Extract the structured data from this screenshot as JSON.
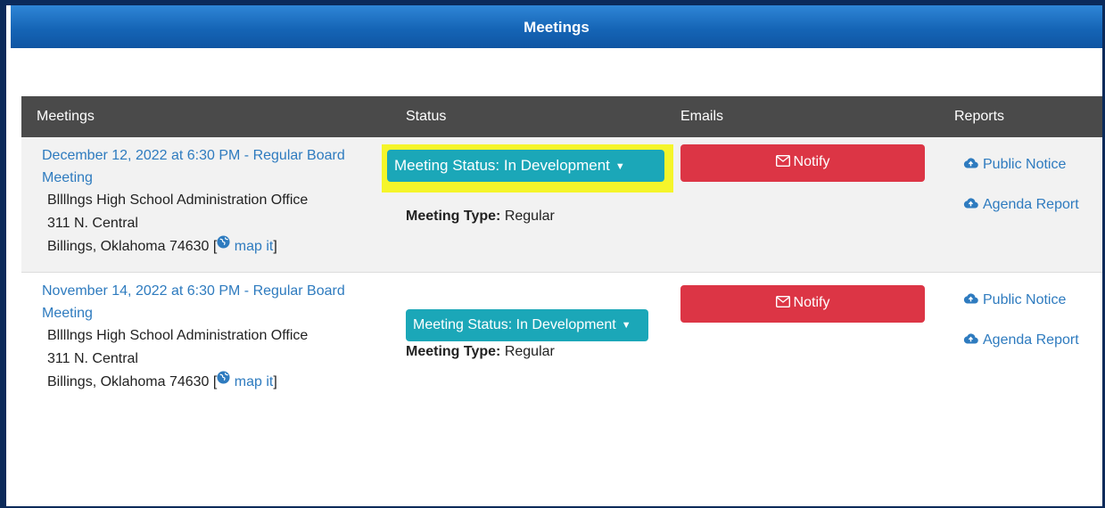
{
  "header": {
    "title": "Meetings"
  },
  "table": {
    "columns": [
      "Meetings",
      "Status",
      "Emails",
      "Reports"
    ],
    "rows": [
      {
        "meeting_title": "December 12, 2022 at 6:30 PM - Regular Board Meeting",
        "address": {
          "line1": "Bllllngs High School Administration Office",
          "line2": "311 N. Central",
          "line3": "Billings, Oklahoma 74630 [",
          "map_link": "map it",
          "line3_end": "]"
        },
        "status_button": "Meeting Status: In Development",
        "meeting_type_label": "Meeting Type:",
        "meeting_type_value": "Regular",
        "notify_label": "Notify",
        "reports": {
          "public_notice": "Public Notice",
          "agenda_report": "Agenda Report"
        },
        "highlighted": true
      },
      {
        "meeting_title": "November 14, 2022 at 6:30 PM - Regular Board Meeting",
        "address": {
          "line1": "Bllllngs High School Administration Office",
          "line2": "311 N. Central",
          "line3": "Billings, Oklahoma 74630 [",
          "map_link": "map it",
          "line3_end": "]"
        },
        "status_button": "Meeting Status: In Development",
        "meeting_type_label": "Meeting Type:",
        "meeting_type_value": "Regular",
        "notify_label": "Notify",
        "reports": {
          "public_notice": "Public Notice",
          "agenda_report": "Agenda Report"
        },
        "highlighted": false
      }
    ]
  },
  "colors": {
    "header_blue": "#1565b6",
    "table_header": "#4a4a4a",
    "link": "#2e7bbf",
    "status_teal": "#1ba7b8",
    "notify_red": "#dc3545",
    "highlight_yellow": "#f5f52a"
  },
  "icons": {
    "notify": "envelope-icon",
    "reports": "cloud-upload-icon",
    "map": "globe-icon",
    "status": "caret-down-icon"
  }
}
